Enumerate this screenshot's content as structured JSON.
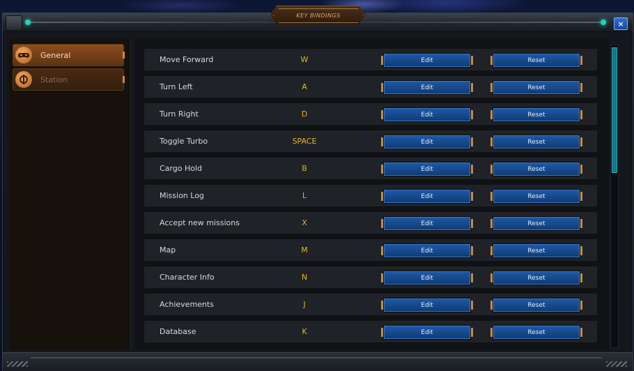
{
  "window": {
    "title": "KEY BINDINGS",
    "close_icon": "×"
  },
  "sidebar": {
    "items": [
      {
        "label": "General",
        "icon": "gamepad-icon",
        "active": true
      },
      {
        "label": "Station",
        "icon": "station-icon",
        "active": false
      }
    ]
  },
  "bindings": [
    {
      "action": "Move Forward",
      "key": "W",
      "edit_label": "Edit",
      "reset_label": "Reset"
    },
    {
      "action": "Turn Left",
      "key": "A",
      "edit_label": "Edit",
      "reset_label": "Reset"
    },
    {
      "action": "Turn Right",
      "key": "D",
      "edit_label": "Edit",
      "reset_label": "Reset"
    },
    {
      "action": "Toggle Turbo",
      "key": "SPACE",
      "edit_label": "Edit",
      "reset_label": "Reset"
    },
    {
      "action": "Cargo Hold",
      "key": "B",
      "edit_label": "Edit",
      "reset_label": "Reset"
    },
    {
      "action": "Mission Log",
      "key": "L",
      "edit_label": "Edit",
      "reset_label": "Reset"
    },
    {
      "action": "Accept new missions",
      "key": "X",
      "edit_label": "Edit",
      "reset_label": "Reset"
    },
    {
      "action": "Map",
      "key": "M",
      "edit_label": "Edit",
      "reset_label": "Reset"
    },
    {
      "action": "Character Info",
      "key": "N",
      "edit_label": "Edit",
      "reset_label": "Reset"
    },
    {
      "action": "Achievements",
      "key": "J",
      "edit_label": "Edit",
      "reset_label": "Reset"
    },
    {
      "action": "Database",
      "key": "K",
      "edit_label": "Edit",
      "reset_label": "Reset"
    }
  ],
  "colors": {
    "key_text": "#e6b628",
    "button_blue": "#1e5aa6",
    "sidebar_active": "#8e4d1e",
    "title_text": "#f0a860",
    "scrollbar_teal": "#1d8a95"
  }
}
